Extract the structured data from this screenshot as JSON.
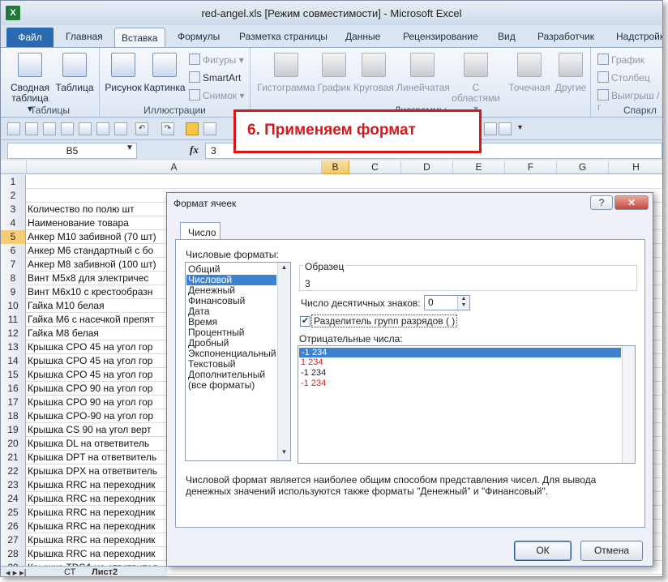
{
  "window": {
    "title": "red-angel.xls  [Режим совместимости]  -  Microsoft Excel",
    "app_icon": "X"
  },
  "tabs": [
    "Файл",
    "Главная",
    "Вставка",
    "Формулы",
    "Разметка страницы",
    "Данные",
    "Рецензирование",
    "Вид",
    "Разработчик",
    "Надстройки"
  ],
  "ribbon": {
    "groups": {
      "tables": "Таблицы",
      "illustrations": "Иллюстрации",
      "charts": "Диаграммы",
      "sparklines": "Спаркл"
    },
    "pivot_table": [
      "Сводная",
      "таблица ▾"
    ],
    "table": "Таблица",
    "picture": "Рисунок",
    "clipart": "Картинка",
    "shapes": "Фигуры ▾",
    "smartart": "SmartArt",
    "screenshot": "Снимок ▾",
    "histogram": "Гистограмма",
    "graph": "График",
    "pie": "Круговая",
    "bar": "Линейчатая",
    "area": [
      "С",
      "областями ▾"
    ],
    "scatter": "Точечная",
    "other": "Другие",
    "sp_line": "График",
    "sp_column": "Столбец",
    "sp_winloss": "Выигрыш / г"
  },
  "formula_bar": {
    "name_box": "B5",
    "fx": "fx",
    "value": "3"
  },
  "annotation": "6. Применяем формат",
  "columns": [
    "A",
    "B",
    "C",
    "D",
    "E",
    "F",
    "G",
    "H"
  ],
  "rows": [
    {
      "n": "1",
      "a": ""
    },
    {
      "n": "2",
      "a": ""
    },
    {
      "n": "3",
      "a": "Количество по полю шт"
    },
    {
      "n": "4",
      "a": "Наименование товара"
    },
    {
      "n": "5",
      "a": "Анкер M10 забивной (70 шт)"
    },
    {
      "n": "6",
      "a": "Анкер M6 стандартный с бо"
    },
    {
      "n": "7",
      "a": "Анкер M8 забивной (100 шт)"
    },
    {
      "n": "8",
      "a": "Винт M5x8 для электричес"
    },
    {
      "n": "9",
      "a": "Винт M6x10 с крестообразн"
    },
    {
      "n": "10",
      "a": "Гайка M10 белая"
    },
    {
      "n": "11",
      "a": "Гайка M6 с насечкой препят"
    },
    {
      "n": "12",
      "a": "Гайка M8 белая"
    },
    {
      "n": "13",
      "a": "Крышка CPO 45 на  угол гор"
    },
    {
      "n": "14",
      "a": "Крышка CPO 45 на угол гор"
    },
    {
      "n": "15",
      "a": "Крышка CPO 45 на угол гор"
    },
    {
      "n": "16",
      "a": "Крышка CPO 90 на угол гор"
    },
    {
      "n": "17",
      "a": "Крышка CPO 90 на угол гор"
    },
    {
      "n": "18",
      "a": "Крышка CPO-90 на угол гор"
    },
    {
      "n": "19",
      "a": "Крышка CS 90 на угол верт"
    },
    {
      "n": "20",
      "a": "Крышка DL на ответвитель"
    },
    {
      "n": "21",
      "a": "Крышка DPT на ответвитель"
    },
    {
      "n": "22",
      "a": "Крышка DPX на ответвитель"
    },
    {
      "n": "23",
      "a": "Крышка RRC на переходник"
    },
    {
      "n": "24",
      "a": "Крышка RRC на переходник"
    },
    {
      "n": "25",
      "a": "Крышка RRC на переходник"
    },
    {
      "n": "26",
      "a": "Крышка RRC на переходник"
    },
    {
      "n": "27",
      "a": "Крышка RRC на переходник"
    },
    {
      "n": "28",
      "a": "Крышка RRC на переходник"
    },
    {
      "n": "29",
      "a": "Крышка TDSA на ответвител"
    }
  ],
  "dialog": {
    "title": "Формат ячеек",
    "help": "?",
    "close": "✕",
    "tab": "Число",
    "formats_label": "Числовые форматы:",
    "formats": [
      "Общий",
      "Числовой",
      "Денежный",
      "Финансовый",
      "Дата",
      "Время",
      "Процентный",
      "Дробный",
      "Экспоненциальный",
      "Текстовый",
      "Дополнительный",
      "(все форматы)"
    ],
    "sample_label": "Образец",
    "sample_value": "3",
    "decimals_label": "Число десятичных знаков:",
    "decimals_value": "0",
    "separator_label": "Разделитель групп разрядов ( )",
    "negatives_label": "Отрицательные числа:",
    "negatives": [
      "-1 234",
      "1 234",
      "-1 234",
      "-1 234"
    ],
    "description": "Числовой формат является наиболее общим способом представления чисел. Для вывода денежных значений используются также форматы \"Денежный\" и \"Финансовый\".",
    "ok": "ОК",
    "cancel": "Отмена"
  },
  "sheet_tabs": {
    "nav": "◂ ▸ ▸|",
    "tab1": "СТ",
    "tab2": "Лист2"
  },
  "colors": {
    "accent": "#2a6ab3",
    "selection": "#3d82d0",
    "annotation": "#d61818",
    "negative_red": "#e01b1b"
  }
}
